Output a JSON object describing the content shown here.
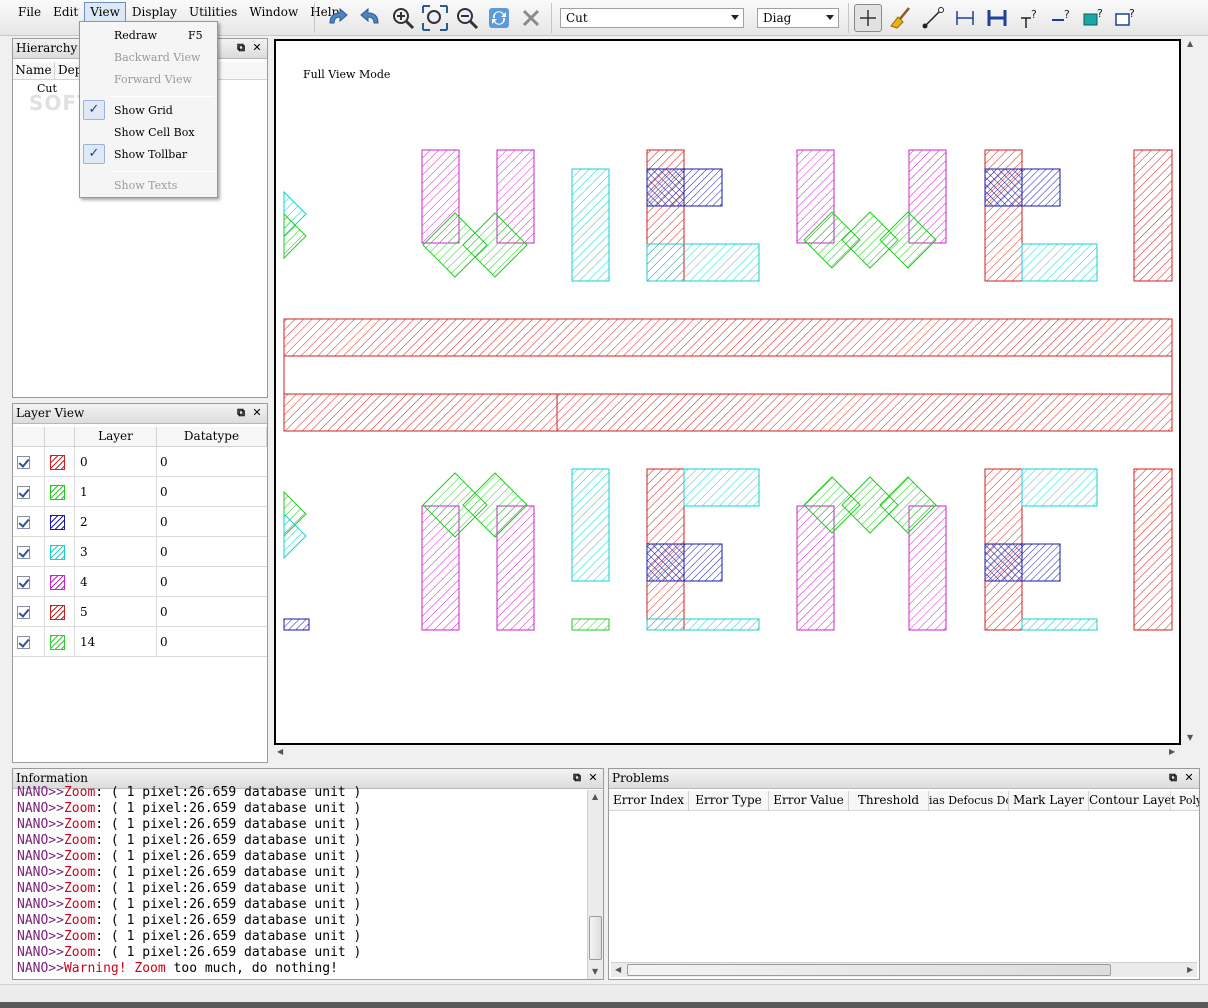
{
  "menus": [
    "File",
    "Edit",
    "View",
    "Display",
    "Utilities",
    "Window",
    "Help"
  ],
  "toolbar": {
    "cell_combo": "Cut",
    "fill_combo": "Diag",
    "icons": [
      "redo-icon",
      "undo-icon",
      "zoom-in-icon",
      "zoom-fit-icon",
      "zoom-out-icon",
      "refresh-icon",
      "cancel-icon",
      "select-cross-icon",
      "broom-icon",
      "measure-line-icon",
      "measure-h-icon",
      "measure-h-bold-icon",
      "probe-icon",
      "probe-line-icon",
      "highlight-rect-icon",
      "outline-rect-icon"
    ]
  },
  "view_menu": {
    "items": [
      {
        "label": "Redraw",
        "shortcut": "F5",
        "disabled": false,
        "checked": false
      },
      {
        "label": "Backward View",
        "disabled": true,
        "checked": false
      },
      {
        "label": "Forward View",
        "disabled": true,
        "checked": false
      },
      {
        "label": "Show Grid",
        "disabled": false,
        "checked": true
      },
      {
        "label": "Show Cell Box",
        "disabled": false,
        "checked": false
      },
      {
        "label": "Show Tollbar",
        "disabled": false,
        "checked": true
      },
      {
        "label": "Show Texts",
        "disabled": true,
        "checked": false
      }
    ]
  },
  "hierarchy": {
    "title": "Hierarchy Vie",
    "columns": [
      "Name",
      "Dep"
    ],
    "rows": [
      "Cut"
    ]
  },
  "watermark": "SOFTPEDIA",
  "layer_view": {
    "title": "Layer View",
    "columns": [
      "Layer",
      "Datatype"
    ],
    "rows": [
      {
        "layer": "0",
        "datatype": "0",
        "color": "#d21f1f"
      },
      {
        "layer": "1",
        "datatype": "0",
        "color": "#22cc22"
      },
      {
        "layer": "2",
        "datatype": "0",
        "color": "#1a1aa8"
      },
      {
        "layer": "3",
        "datatype": "0",
        "color": "#19d0d0"
      },
      {
        "layer": "4",
        "datatype": "0",
        "color": "#cc22cc"
      },
      {
        "layer": "5",
        "datatype": "0",
        "color": "#c82020"
      },
      {
        "layer": "14",
        "datatype": "0",
        "color": "#33cc33"
      }
    ]
  },
  "canvas": {
    "mode_label": "Full View Mode"
  },
  "information": {
    "title": "Information",
    "lines": [
      {
        "prefix": "NANO>>",
        "keyword": "Zoom",
        "rest": ": ( 1 pixel:26.659 database unit )"
      },
      {
        "prefix": "NANO>>",
        "keyword": "Zoom",
        "rest": ": ( 1 pixel:26.659 database unit )"
      },
      {
        "prefix": "NANO>>",
        "keyword": "Zoom",
        "rest": ": ( 1 pixel:26.659 database unit )"
      },
      {
        "prefix": "NANO>>",
        "keyword": "Zoom",
        "rest": ": ( 1 pixel:26.659 database unit )"
      },
      {
        "prefix": "NANO>>",
        "keyword": "Zoom",
        "rest": ": ( 1 pixel:26.659 database unit )"
      },
      {
        "prefix": "NANO>>",
        "keyword": "Zoom",
        "rest": ": ( 1 pixel:26.659 database unit )"
      },
      {
        "prefix": "NANO>>",
        "keyword": "Zoom",
        "rest": ": ( 1 pixel:26.659 database unit )"
      },
      {
        "prefix": "NANO>>",
        "keyword": "Zoom",
        "rest": ": ( 1 pixel:26.659 database unit )"
      },
      {
        "prefix": "NANO>>",
        "keyword": "Zoom",
        "rest": ": ( 1 pixel:26.659 database unit )"
      },
      {
        "prefix": "NANO>>",
        "keyword": "Zoom",
        "rest": ": ( 1 pixel:26.659 database unit )"
      },
      {
        "prefix": "NANO>>",
        "keyword": "Zoom",
        "rest": ": ( 1 pixel:26.659 database unit )"
      }
    ],
    "last_line": {
      "prefix": "NANO>>",
      "warning": "Warning! Zoom",
      "rest": " too much, do nothing!"
    }
  },
  "problems": {
    "title": "Problems",
    "columns": [
      "Error Index",
      "Error Type",
      "Error Value",
      "Threshold",
      "ias Defocus Dos",
      "Mark Layer",
      "Contour Layer",
      "t Poly"
    ]
  },
  "colors": {
    "red": "#d21f1f",
    "green": "#22cc22",
    "blue": "#1a1aa8",
    "cyan": "#19d0d0",
    "magenta": "#cc22cc"
  }
}
